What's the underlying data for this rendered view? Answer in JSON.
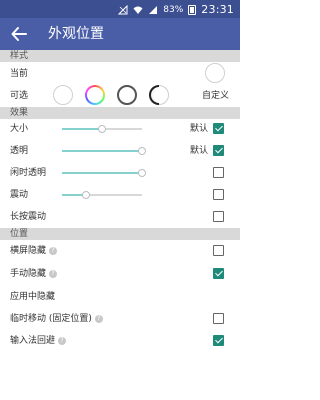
{
  "status_bar": {
    "battery": "83%",
    "time": "23:31"
  },
  "app_bar": {
    "title": "外观位置"
  },
  "sections": {
    "style": {
      "header": "样式",
      "current_label": "当前",
      "options_label": "可选",
      "custom_label": "自定义"
    },
    "effects": {
      "header": "效果",
      "size": {
        "label": "大小",
        "value_label": "默认",
        "checked": true,
        "level": 0.5
      },
      "opacity": {
        "label": "透明",
        "value_label": "默认",
        "checked": true,
        "level": 1.0
      },
      "idle_opacity": {
        "label": "闲时透明",
        "checked": false,
        "level": 1.0
      },
      "vibration": {
        "label": "震动",
        "checked": false,
        "level": 0.3
      },
      "long_press_vibration": {
        "label": "长按震动",
        "checked": false
      }
    },
    "position": {
      "header": "位置",
      "hide_landscape": {
        "label": "横屏隐藏",
        "checked": false
      },
      "hide_manual": {
        "label": "手动隐藏",
        "checked": true
      },
      "hide_in_apps": {
        "label": "应用中隐藏"
      },
      "temp_move": {
        "label": "临时移动 (固定位置)",
        "checked": false
      },
      "ime_avoid": {
        "label": "输入法回避",
        "checked": true
      }
    }
  },
  "colors": {
    "primary": "#4a5ea8",
    "status": "#3c4f91",
    "accent": "#1f8a7a",
    "slider_fill": "#86d1cf"
  }
}
